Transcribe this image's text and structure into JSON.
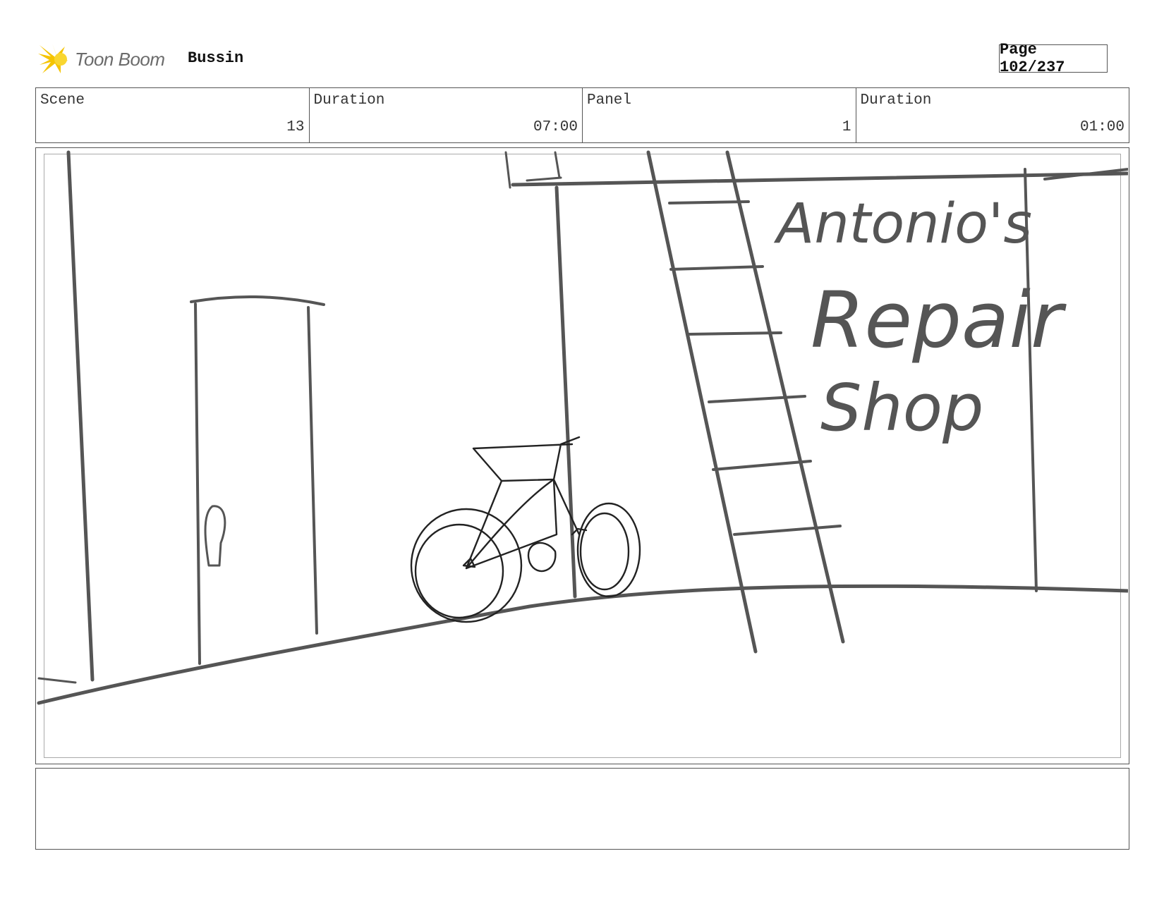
{
  "header": {
    "brand": "Toon Boom",
    "project": "Bussin",
    "page_label": "Page 102/237"
  },
  "info": {
    "scene_label": "Scene",
    "scene_value": "13",
    "scene_duration_label": "Duration",
    "scene_duration_value": "07:00",
    "panel_label": "Panel",
    "panel_value": "1",
    "panel_duration_label": "Duration",
    "panel_duration_value": "01:00"
  },
  "sketch": {
    "sign_line1": "Antonio's",
    "sign_line2": "Repair",
    "sign_line3": "Shop"
  },
  "colors": {
    "line": "#555555",
    "logo_yellow": "#f5c400",
    "logo_text": "#6b6b6b"
  },
  "notes": {
    "text": ""
  }
}
